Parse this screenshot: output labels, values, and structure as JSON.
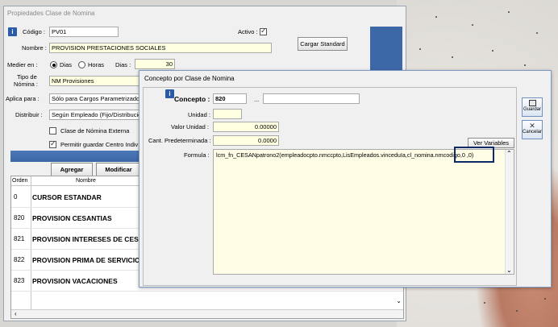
{
  "back_window": {
    "title": "Propiedades Clase de Nomina",
    "codigo_label": "Código :",
    "codigo_value": "PV01",
    "activo_label": "Activo :",
    "nombre_label": "Nombre :",
    "nombre_value": "PROVISION PRESTACIONES SOCIALES",
    "cargar_button": "Cargar Standard",
    "medir_label": "Medier en :",
    "dias_option": "Dias",
    "horas_option": "Horas",
    "dias_label": "Dias :",
    "dias_value": "30",
    "tipo_label_1": "Tipo de",
    "tipo_label_2": "Nómina :",
    "tipo_value": "NM Provisiones",
    "aplica_label": "Aplica para :",
    "aplica_value": "Sólo para Cargos Parametrizados",
    "distribuir_label": "Distribuir :",
    "distribuir_value": "Según Empleado (Fijo/Distribución)",
    "clase_externa_label": "Clase de Nómina Externa",
    "permitir_label": "Permitir guardar Centro Indiv",
    "agregar_button": "Agregar",
    "modificar_button": "Modificar",
    "grid": {
      "headers": [
        "Orden",
        "Nombre"
      ],
      "rows": [
        {
          "orden": "0",
          "nombre": "CURSOR ESTANDAR"
        },
        {
          "orden": "820",
          "nombre": "PROVISION CESANTIAS"
        },
        {
          "orden": "821",
          "nombre": "PROVISION INTERESES DE CES"
        },
        {
          "orden": "822",
          "nombre": "PROVISION PRIMA DE SERVICIO"
        },
        {
          "orden": "823",
          "nombre": "PROVISION VACACIONES"
        }
      ]
    }
  },
  "dialog": {
    "title": "Concepto por Clase de Nomina",
    "concepto_label": "Concepto :",
    "concepto_value": "820",
    "concepto_ellipsis": "...",
    "concepto_desc": "",
    "unidad_label": "Unidad :",
    "unidad_value": "",
    "valor_label": "Valor Unidad :",
    "valor_value": "0.00000",
    "cant_label": "Cant. Predeterminada :",
    "cant_value": "0.0000",
    "ver_variables_button": "Ver Variables",
    "formula_label": "Formula :",
    "formula_value": "lcm_fn_CESANpatrono2(empleadocpto.nmccpto,LisEmpleados.vinceduIa,cl_nomina.nmcodigo,0 ,0)",
    "guardar_button": "Guardar",
    "cancelar_button": "Cancelar"
  },
  "colors": {
    "highlight_border": "#0b2a66",
    "formula_bg": "#fffde6",
    "header_blue": "#3d68a8"
  }
}
